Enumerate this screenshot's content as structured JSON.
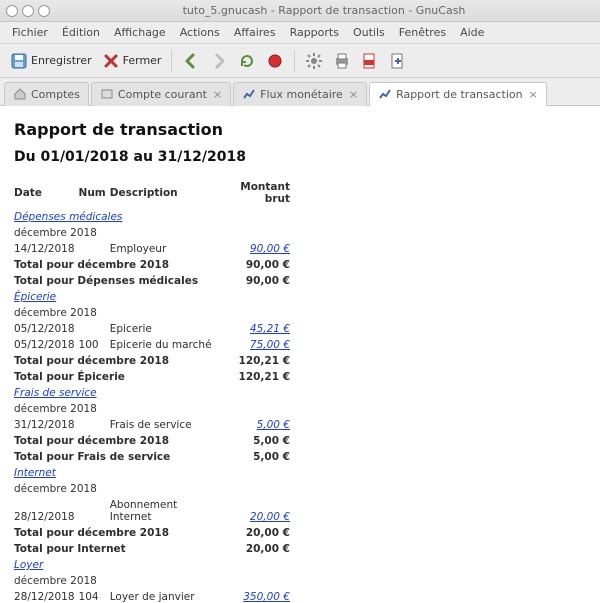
{
  "window": {
    "title": "tuto_5.gnucash - Rapport de transaction - GnuCash"
  },
  "menu": {
    "file": "Fichier",
    "edit": "Édition",
    "view": "Affichage",
    "actions": "Actions",
    "business": "Affaires",
    "reports": "Rapports",
    "tools": "Outils",
    "windows": "Fenêtres",
    "help": "Aide"
  },
  "toolbar": {
    "save": "Enregistrer",
    "close": "Fermer"
  },
  "tabs": {
    "accounts": "Comptes",
    "current": "Compte courant",
    "cashflow": "Flux monétaire",
    "report": "Rapport de transaction"
  },
  "report": {
    "title": "Rapport de transaction",
    "period": "Du 01/01/2018 au 31/12/2018",
    "headers": {
      "date": "Date",
      "num": "Num",
      "desc": "Description",
      "amount": "Montant brut"
    },
    "sections": [
      {
        "category": "Dépenses médicales",
        "month": "décembre 2018",
        "rows": [
          {
            "date": "14/12/2018",
            "num": "",
            "desc": "Employeur",
            "amount": "90,00 €"
          }
        ],
        "total_month_label": "Total pour décembre 2018",
        "total_month_value": "90,00 €",
        "total_cat_label": "Total pour Dépenses médicales",
        "total_cat_value": "90,00 €"
      },
      {
        "category": "Épicerie",
        "month": "décembre 2018",
        "rows": [
          {
            "date": "05/12/2018",
            "num": "",
            "desc": "Epicerie",
            "amount": "45,21 €"
          },
          {
            "date": "05/12/2018",
            "num": "100",
            "desc": "Epicerie du marché",
            "amount": "75,00 €"
          }
        ],
        "total_month_label": "Total pour décembre 2018",
        "total_month_value": "120,21 €",
        "total_cat_label": "Total pour Épicerie",
        "total_cat_value": "120,21 €"
      },
      {
        "category": "Frais de service",
        "month": "décembre 2018",
        "rows": [
          {
            "date": "31/12/2018",
            "num": "",
            "desc": "Frais de service",
            "amount": "5,00 €"
          }
        ],
        "total_month_label": "Total pour décembre 2018",
        "total_month_value": "5,00 €",
        "total_cat_label": "Total pour Frais de service",
        "total_cat_value": "5,00 €"
      },
      {
        "category": "Internet",
        "month": "décembre 2018",
        "rows": [
          {
            "date": "28/12/2018",
            "num": "",
            "desc": "Abonnement Internet",
            "amount": "20,00 €"
          }
        ],
        "total_month_label": "Total pour décembre 2018",
        "total_month_value": "20,00 €",
        "total_cat_label": "Total pour Internet",
        "total_cat_value": "20,00 €"
      },
      {
        "category": "Loyer",
        "month": "décembre 2018",
        "rows": [
          {
            "date": "28/12/2018",
            "num": "104",
            "desc": "Loyer de janvier",
            "amount": "350,00 €"
          }
        ],
        "total_month_label": "",
        "total_month_value": "",
        "total_cat_label": "",
        "total_cat_value": ""
      }
    ]
  }
}
